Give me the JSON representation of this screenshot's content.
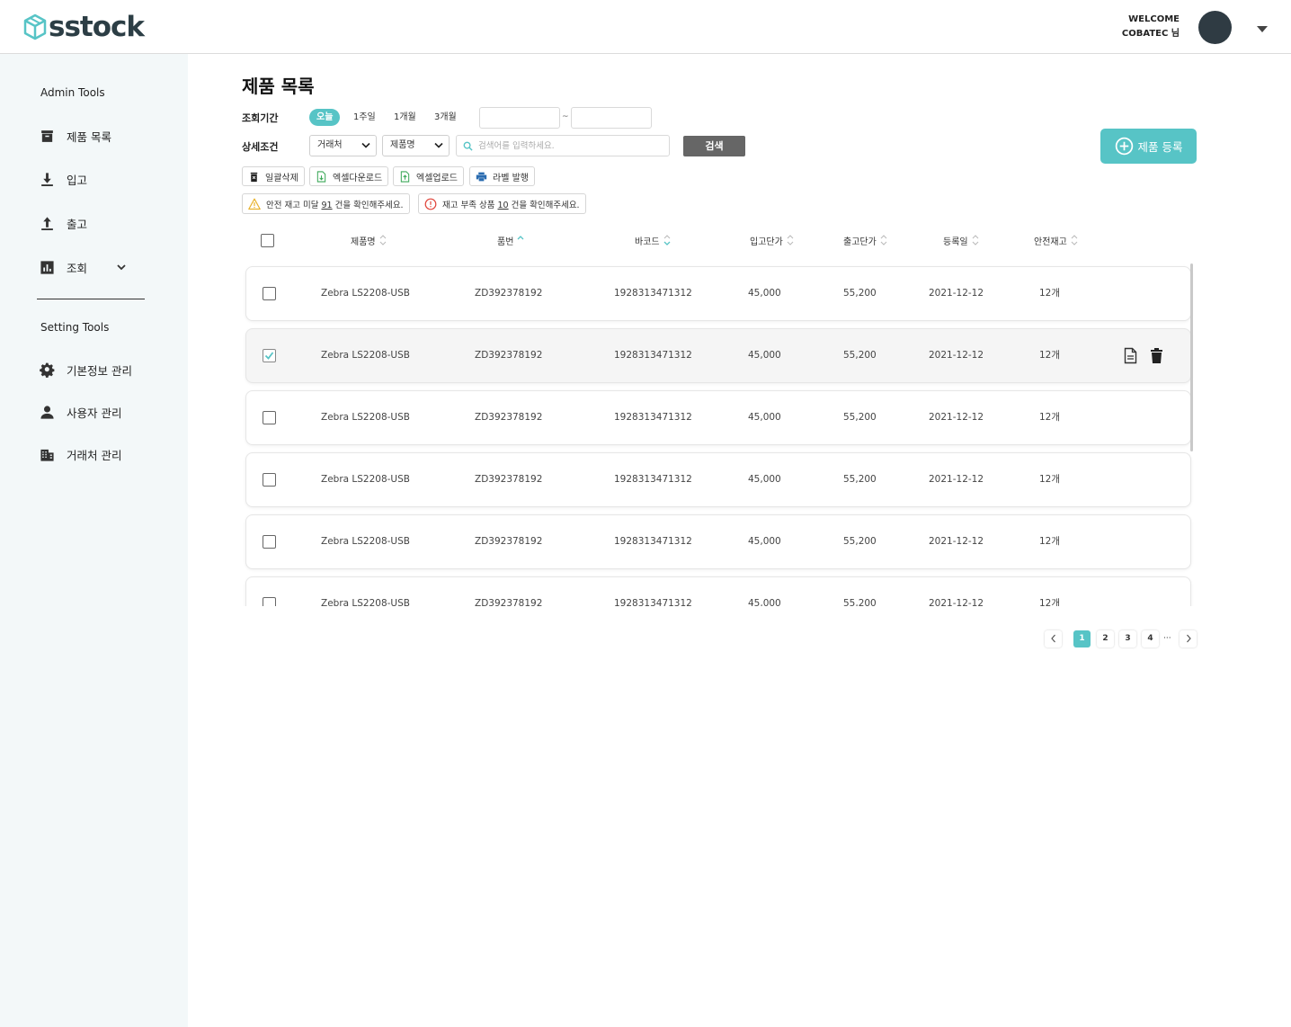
{
  "header": {
    "logo_text": "sstock",
    "welcome": "WELCOME",
    "user": "COBATEC 님"
  },
  "sidebar": {
    "admin_title": "Admin Tools",
    "admin_items": [
      {
        "label": "제품 목록",
        "icon": "archive-box-icon"
      },
      {
        "label": "입고",
        "icon": "download-icon"
      },
      {
        "label": "출고",
        "icon": "upload-icon"
      },
      {
        "label": "조회",
        "icon": "bar-chart-icon"
      }
    ],
    "setting_title": "Setting Tools",
    "setting_items": [
      {
        "label": "기본정보 관리",
        "icon": "gear-icon"
      },
      {
        "label": "사용자 관리",
        "icon": "person-icon"
      },
      {
        "label": "거래처 관리",
        "icon": "building-icon"
      }
    ]
  },
  "page": {
    "title": "제품 목록",
    "period_label": "조회기간",
    "period_options": [
      "오늘",
      "1주일",
      "1개월",
      "3개월"
    ],
    "period_active": "오늘",
    "date_separator": "~",
    "detail_label": "상세조건",
    "select_vendor": "거래처",
    "select_product": "제품명",
    "search_placeholder": "검색어를 입력하세요.",
    "search_button": "검색",
    "register_button": "제품 등록"
  },
  "toolbar": {
    "bulk_delete": "일괄삭제",
    "excel_download": "엑셀다운로드",
    "excel_upload": "엑셀업로드",
    "label_print": "라벨 발행"
  },
  "alerts": {
    "safety_pre": "안전 재고 미달 ",
    "safety_count": "91",
    "safety_post": " 건을 확인해주세요.",
    "shortage_pre": "재고 부족 상품 ",
    "shortage_count": "10",
    "shortage_post": " 건을 확인해주세요."
  },
  "table": {
    "columns": [
      "제품명",
      "품번",
      "바코드",
      "입고단가",
      "출고단가",
      "등록일",
      "안전재고"
    ],
    "rows": [
      {
        "name": "Zebra LS2208-USB",
        "part": "ZD392378192",
        "barcode": "1928313471312",
        "in_price": "45,000",
        "out_price": "55,200",
        "date": "2021-12-12",
        "safety": "12개",
        "checked": false
      },
      {
        "name": "Zebra LS2208-USB",
        "part": "ZD392378192",
        "barcode": "1928313471312",
        "in_price": "45,000",
        "out_price": "55,200",
        "date": "2021-12-12",
        "safety": "12개",
        "checked": true
      },
      {
        "name": "Zebra LS2208-USB",
        "part": "ZD392378192",
        "barcode": "1928313471312",
        "in_price": "45,000",
        "out_price": "55,200",
        "date": "2021-12-12",
        "safety": "12개",
        "checked": false
      },
      {
        "name": "Zebra LS2208-USB",
        "part": "ZD392378192",
        "barcode": "1928313471312",
        "in_price": "45,000",
        "out_price": "55,200",
        "date": "2021-12-12",
        "safety": "12개",
        "checked": false
      },
      {
        "name": "Zebra LS2208-USB",
        "part": "ZD392378192",
        "barcode": "1928313471312",
        "in_price": "45,000",
        "out_price": "55,200",
        "date": "2021-12-12",
        "safety": "12개",
        "checked": false
      },
      {
        "name": "Zebra LS2208-USB",
        "part": "ZD392378192",
        "barcode": "1928313471312",
        "in_price": "45,000",
        "out_price": "55,200",
        "date": "2021-12-12",
        "safety": "12개",
        "checked": false
      }
    ]
  },
  "pagination": {
    "pages": [
      "1",
      "2",
      "3",
      "4"
    ],
    "active": "1",
    "ellipsis": "···"
  },
  "colors": {
    "accent": "#57c4c6",
    "sidebar_bg": "#f3f8f9",
    "dark": "#2f3b43"
  }
}
